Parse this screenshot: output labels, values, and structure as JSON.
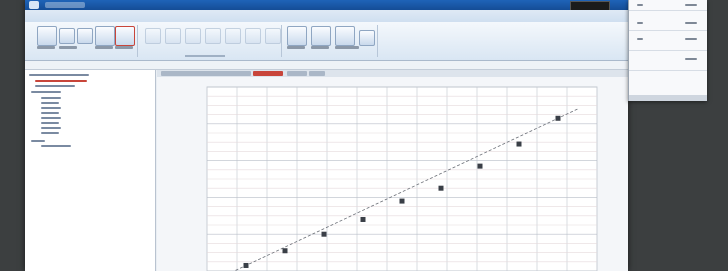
{
  "chart_data": {
    "type": "scatter",
    "title": "",
    "xlabel": "",
    "ylabel": "",
    "xlim": [
      0,
      10
    ],
    "ylim": [
      0,
      10
    ],
    "grid": true,
    "points": [
      {
        "x": 1.0,
        "y": 0.3
      },
      {
        "x": 2.0,
        "y": 1.1
      },
      {
        "x": 3.0,
        "y": 2.0
      },
      {
        "x": 4.0,
        "y": 2.8
      },
      {
        "x": 5.0,
        "y": 3.8
      },
      {
        "x": 6.0,
        "y": 4.5
      },
      {
        "x": 7.0,
        "y": 5.7
      },
      {
        "x": 8.0,
        "y": 6.9
      },
      {
        "x": 9.0,
        "y": 8.3
      }
    ],
    "fit_line": {
      "x": [
        0.5,
        9.5
      ],
      "y": [
        -0.2,
        8.8
      ]
    }
  },
  "colors": {
    "titlebar": "#1f63b8",
    "ribbon": "#e1ebf6",
    "accent_red": "#c8453a",
    "background": "#3c3f40"
  }
}
